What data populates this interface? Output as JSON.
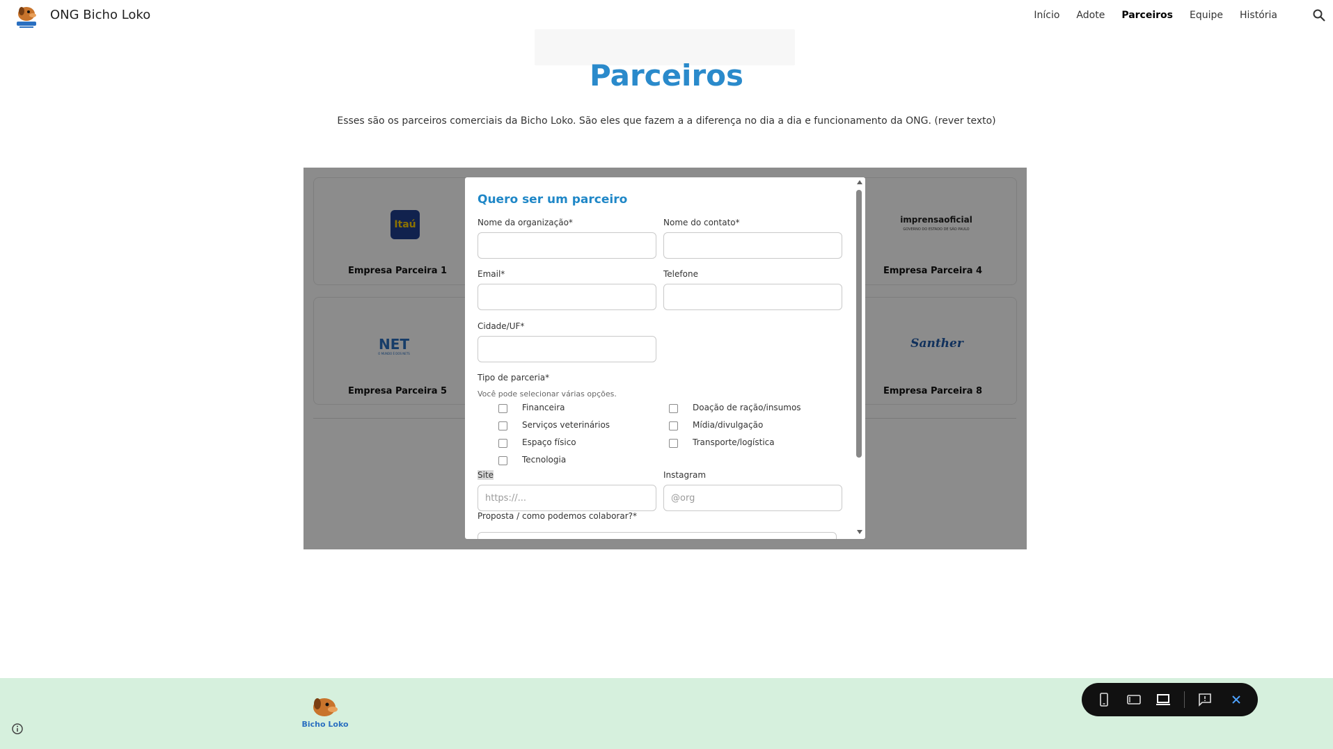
{
  "header": {
    "site_title": "ONG Bicho Loko",
    "logo_icon": "bicho-loko-dog-logo",
    "nav": [
      {
        "label": "Início",
        "active": false
      },
      {
        "label": "Adote",
        "active": false
      },
      {
        "label": "Parceiros",
        "active": true
      },
      {
        "label": "Equipe",
        "active": false
      },
      {
        "label": "História",
        "active": false
      }
    ],
    "search_icon": "search-icon"
  },
  "page": {
    "title": "Parceiros",
    "intro": "Esses são os parceiros comerciais da Bicho Loko. São eles que fazem a a diferença no dia a dia e funcionamento da ONG. (rever texto)"
  },
  "partners": [
    {
      "name": "Empresa Parceira 1",
      "logo": "Itaú"
    },
    {
      "name": "Empresa Parceira 4",
      "logo": "imprensaoficial"
    },
    {
      "name": "Empresa Parceira 5",
      "logo": "NET"
    },
    {
      "name": "Empresa Parceira 8",
      "logo": "Santher"
    }
  ],
  "partner_logo_texts": {
    "imprensa_sub": "GOVERNO DO ESTADO DE SÃO PAULO",
    "net_sub": "O MUNDO É DOS NETS"
  },
  "form": {
    "title": "Quero ser um parceiro",
    "org_name_label": "Nome da organização*",
    "org_name_value": "",
    "contact_name_label": "Nome do contato*",
    "contact_name_value": "",
    "email_label": "Email*",
    "email_value": "",
    "phone_label": "Telefone",
    "phone_value": "",
    "city_label": "Cidade/UF*",
    "city_value": "",
    "type_label": "Tipo de parceria*",
    "type_hint": "Você pode selecionar várias opções.",
    "options_left": [
      "Financeira",
      "Serviços veterinários",
      "Espaço físico",
      "Tecnologia"
    ],
    "options_right": [
      "Doação de ração/insumos",
      "Mídia/divulgação",
      "Transporte/logística"
    ],
    "site_label": "Site",
    "site_placeholder": "https://...",
    "instagram_label": "Instagram",
    "instagram_placeholder": "@org",
    "proposal_label": "Proposta / como podemos colaborar?*"
  },
  "footer": {
    "logo_text": "Bicho Loko",
    "info_icon": "info-icon"
  },
  "preview_toolbar": {
    "icons": [
      "phone-preview-icon",
      "tablet-preview-icon",
      "laptop-preview-icon",
      "report-icon",
      "close-icon"
    ]
  },
  "colors": {
    "accent": "#2a8acb",
    "footer_bg": "#d6f0dd",
    "toolbar_bg": "#111111"
  }
}
